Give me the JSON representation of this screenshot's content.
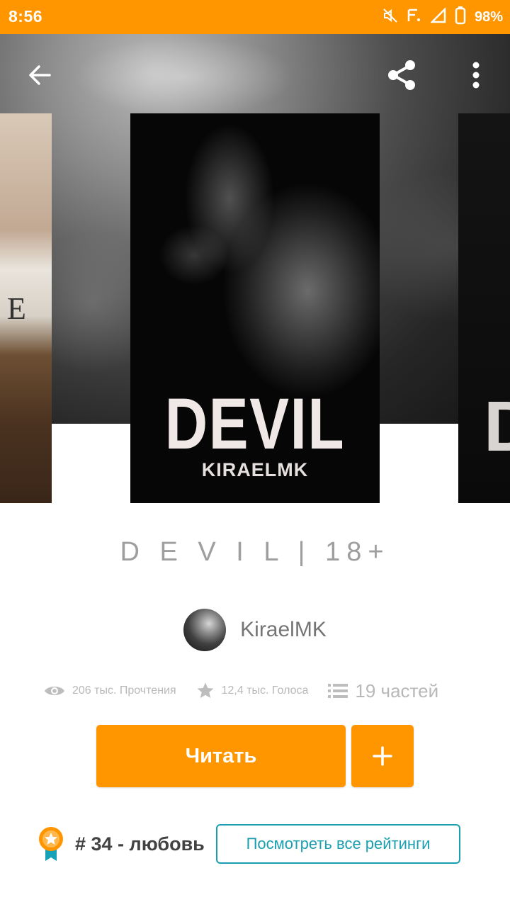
{
  "status_bar": {
    "time": "8:56",
    "battery": "98%",
    "icons": [
      "mute-icon",
      "network-type-icon",
      "signal-icon",
      "battery-icon"
    ]
  },
  "toolbar": {
    "icons": [
      "back-arrow-icon",
      "share-icon",
      "more-vertical-icon"
    ]
  },
  "covers": {
    "left_letter": "E",
    "main_title": "DEVIL",
    "main_author": "KIRAELMK",
    "right_letter": "D"
  },
  "book": {
    "title": "D E V I L | 18+",
    "author": "KiraelMK"
  },
  "stats": {
    "reads": "206 тыс. Прочтения",
    "votes": "12,4 тыс. Голоса",
    "parts": "19 частей"
  },
  "actions": {
    "read_label": "Читать",
    "add_icon": "plus-icon"
  },
  "ranking": {
    "text": "# 34 - любовь",
    "view_all_label": "Посмотреть все рейтинги"
  },
  "colors": {
    "accent": "#ff9600",
    "link": "#1a9fb0",
    "muted": "#b8b8b8"
  }
}
